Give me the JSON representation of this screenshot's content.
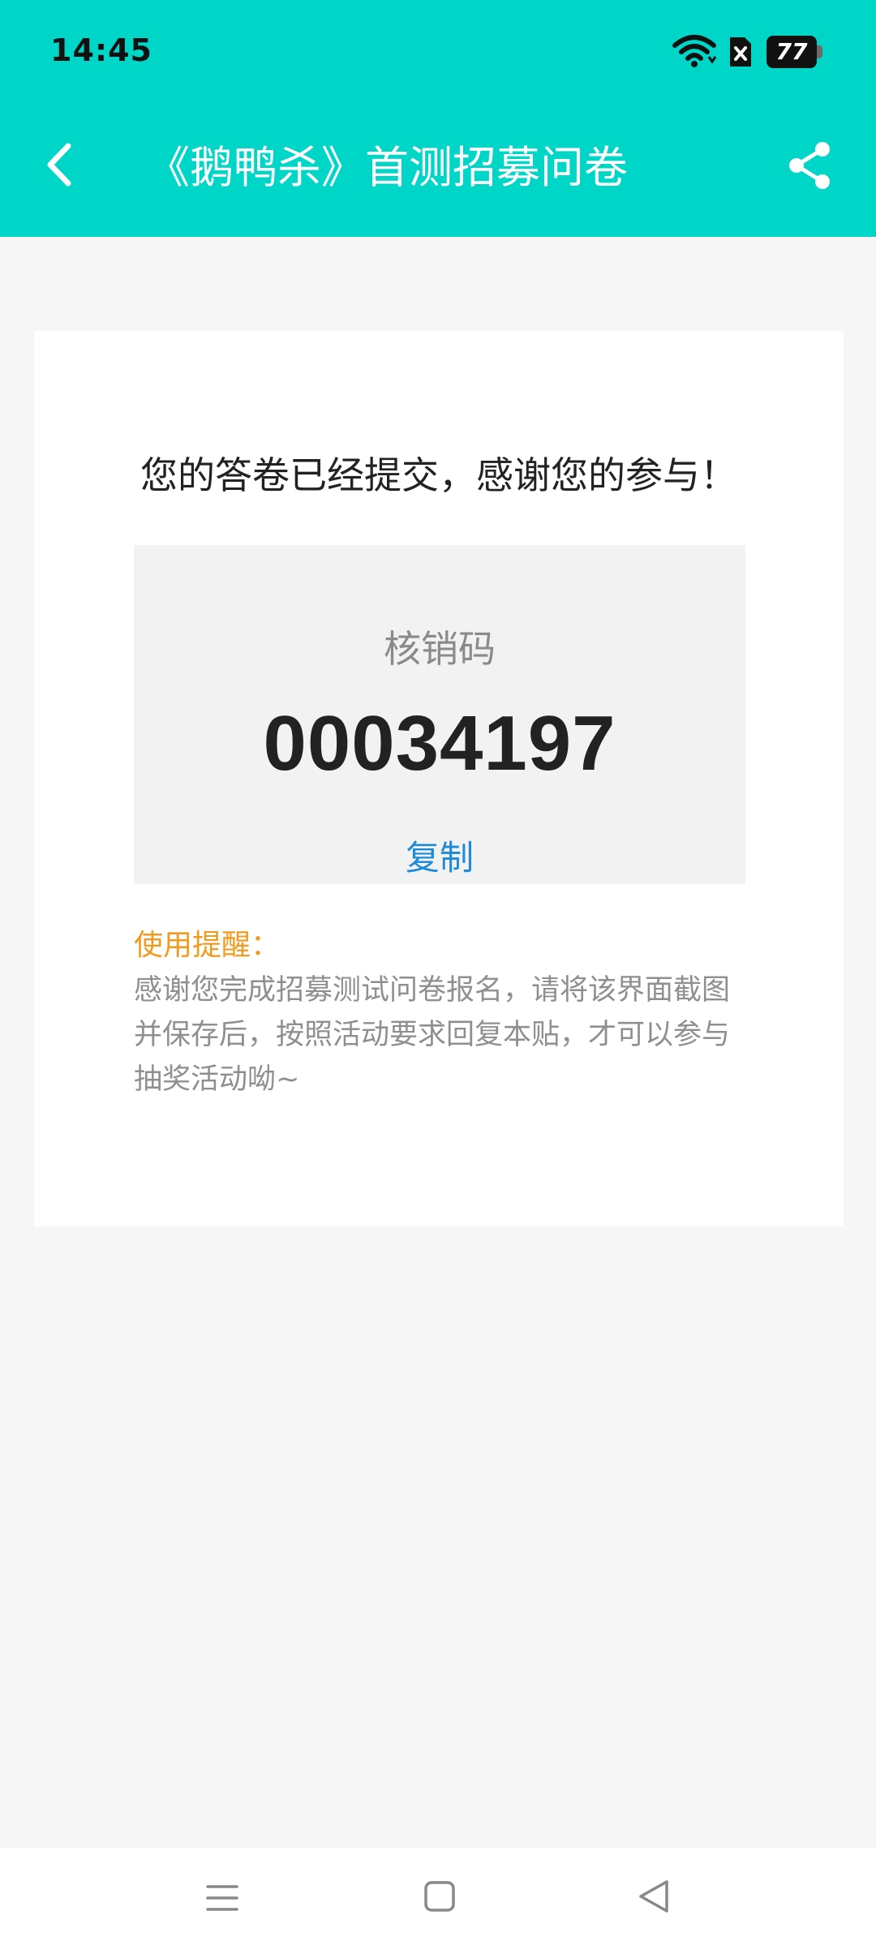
{
  "status_bar": {
    "time": "14:45",
    "battery": "77",
    "icons": [
      "wifi-icon",
      "sim-icon",
      "battery-icon"
    ]
  },
  "app_bar": {
    "title": "《鹅鸭杀》首测招募问卷",
    "back_icon": "chevron-left-icon",
    "share_icon": "share-icon"
  },
  "card": {
    "success_message": "您的答卷已经提交，感谢您的参与！",
    "code_label": "核销码",
    "code_value": "00034197",
    "copy_label": "复制",
    "reminder_title": "使用提醒：",
    "reminder_text": "感谢您完成招募测试问卷报名，请将该界面截图并保存后，按照活动要求回复本贴，才可以参与抽奖活动呦~"
  },
  "nav_bar": {
    "icons": [
      "menu-icon",
      "home-icon",
      "back-icon"
    ]
  },
  "colors": {
    "header": "#00d6c7",
    "link": "#1e8ad8",
    "reminder": "#f39a1e",
    "background": "#f6f6f6"
  }
}
